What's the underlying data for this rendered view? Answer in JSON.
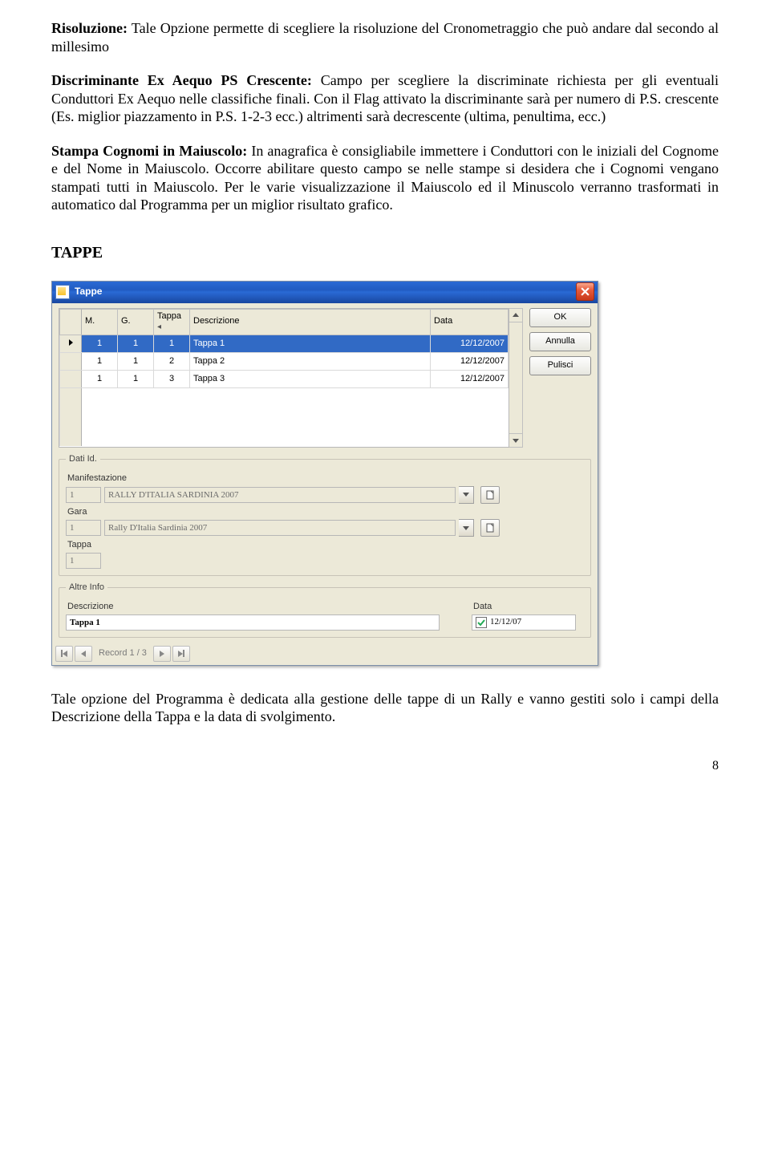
{
  "text": {
    "p1a": "Risoluzione:",
    "p1b": " Tale Opzione permette di scegliere la risoluzione del Cronometraggio che può andare dal secondo al millesimo",
    "p2a": "Discriminante Ex Aequo PS Crescente:",
    "p2b": " Campo per scegliere la discriminate richiesta per gli eventuali Conduttori Ex Aequo nelle classifiche finali. Con il Flag attivato la discriminante sarà per numero di P.S. crescente (Es. miglior piazzamento in P.S. 1-2-3 ecc.) altrimenti sarà decrescente (ultima, penultima, ecc.)",
    "p3a": "Stampa Cognomi in Maiuscolo:",
    "p3b": " In anagrafica è consigliabile immettere i Conduttori con le iniziali del Cognome e del Nome in Maiuscolo. Occorre abilitare questo campo se nelle stampe si desidera che i Cognomi vengano stampati tutti in Maiuscolo.  Per le varie visualizzazione il Maiuscolo ed il Minuscolo verranno trasformati in automatico dal Programma per un miglior risultato grafico.",
    "section": "TAPPE",
    "p4": "Tale opzione del Programma è dedicata alla gestione delle tappe di un  Rally e vanno gestiti solo i campi della Descrizione della Tappa e la data di svolgimento.",
    "page": "8"
  },
  "win": {
    "title": "Tappe",
    "btn_ok": "OK",
    "btn_cancel": "Annulla",
    "btn_clear": "Pulisci",
    "cols": {
      "m": "M.",
      "g": "G.",
      "tappa": "Tappa",
      "descr": "Descrizione",
      "data": "Data"
    },
    "rows": [
      {
        "m": "1",
        "g": "1",
        "t": "1",
        "d": "Tappa 1",
        "dt": "12/12/2007"
      },
      {
        "m": "1",
        "g": "1",
        "t": "2",
        "d": "Tappa 2",
        "dt": "12/12/2007"
      },
      {
        "m": "1",
        "g": "1",
        "t": "3",
        "d": "Tappa 3",
        "dt": "12/12/2007"
      }
    ],
    "fs1": {
      "legend": "Dati Id.",
      "manif_lbl": "Manifestazione",
      "manif_id": "1",
      "manif_txt": "RALLY D'ITALIA SARDINIA 2007",
      "gara_lbl": "Gara",
      "gara_id": "1",
      "gara_txt": "Rally D'Italia Sardinia 2007",
      "tappa_lbl": "Tappa",
      "tappa_id": "1"
    },
    "fs2": {
      "legend": "Altre Info",
      "descr_lbl": "Descrizione",
      "descr_val": "Tappa 1",
      "data_lbl": "Data",
      "data_val": "12/12/07"
    },
    "nav": "Record 1 / 3"
  }
}
